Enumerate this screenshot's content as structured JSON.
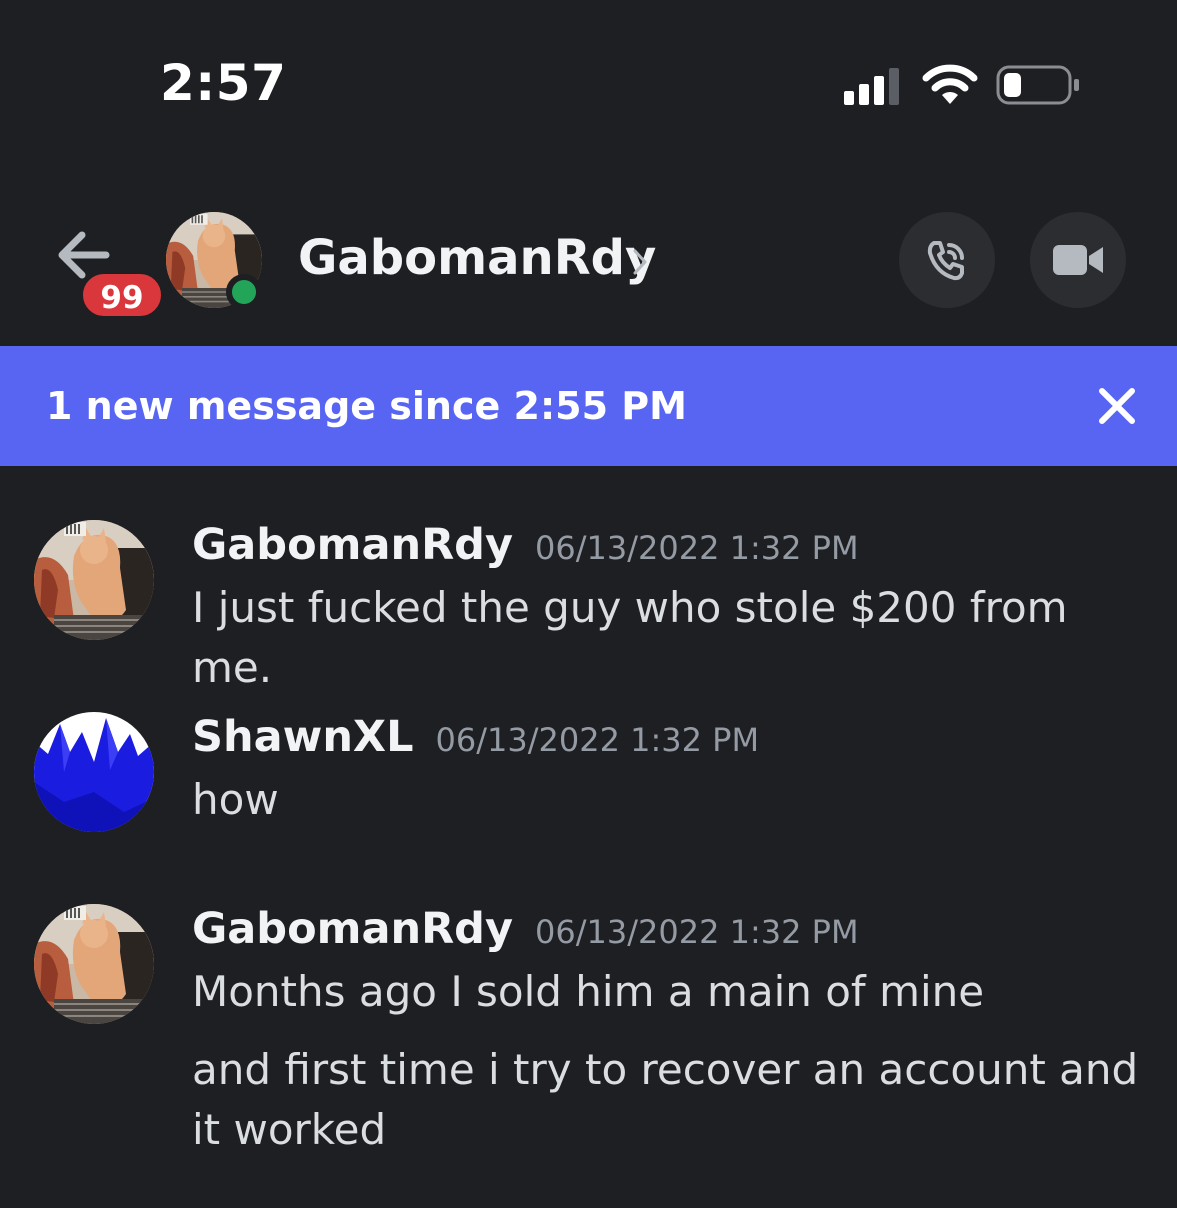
{
  "status_bar": {
    "time": "2:57",
    "icons": [
      "signal-icon",
      "wifi-icon",
      "battery-icon"
    ]
  },
  "header": {
    "back_icon": "arrow-left-icon",
    "unread_badge": "99",
    "user_name": "GabomanRdy",
    "status": "online",
    "chevron": "›",
    "call_icon": "phone-call-icon",
    "video_icon": "video-camera-icon"
  },
  "banner": {
    "text": "1 new message since 2:55 PM",
    "close_icon": "close-icon"
  },
  "messages": [
    {
      "author": "GabomanRdy",
      "timestamp": "06/13/2022 1:32 PM",
      "lines": [
        "I just fucked the guy who stole $200 from me."
      ],
      "avatar": "cat-avatar"
    },
    {
      "author": "ShawnXL",
      "timestamp": "06/13/2022 1:32 PM",
      "lines": [
        "how"
      ],
      "avatar": "blue-spikes-avatar"
    },
    {
      "author": "GabomanRdy",
      "timestamp": "06/13/2022 1:32 PM",
      "lines": [
        "Months ago I sold him a main of mine",
        "and first time i try to recover an account and it worked"
      ],
      "avatar": "cat-avatar"
    }
  ],
  "colors": {
    "background": "#1e1f22",
    "banner": "#5865f2",
    "badge": "#da373c",
    "online": "#23a559",
    "timestamp": "#949ba4"
  }
}
